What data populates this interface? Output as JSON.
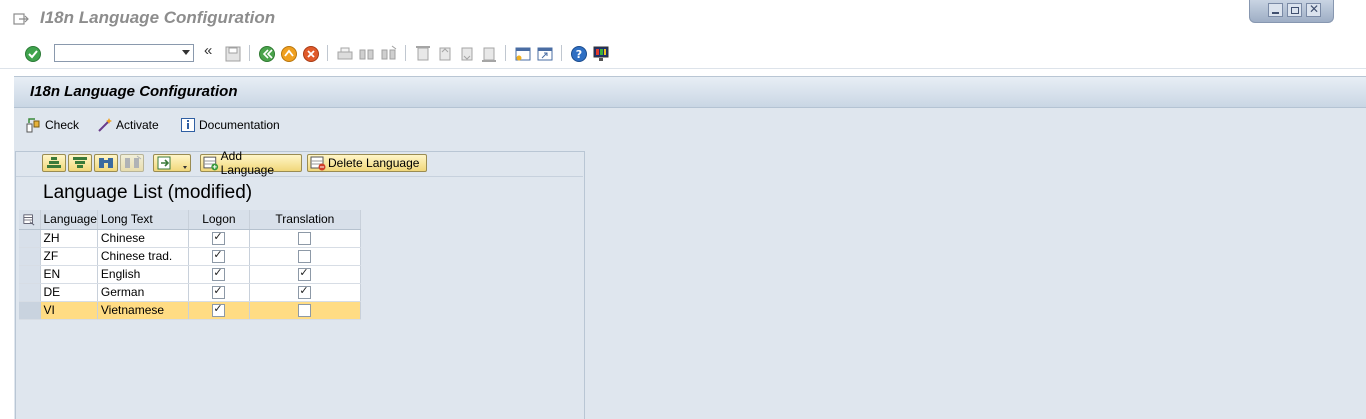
{
  "window": {
    "title": "I18n Language Configuration"
  },
  "toolbar": {
    "command_value": ""
  },
  "screen": {
    "title": "I18n Language Configuration"
  },
  "appbar": {
    "check_label": "Check",
    "activate_label": "Activate",
    "documentation_label": "Documentation"
  },
  "alv": {
    "add_label": "Add Language",
    "delete_label": "Delete Language",
    "title": "Language List (modified)",
    "columns": [
      "Language",
      "Long Text",
      "Logon",
      "Translation"
    ],
    "rows": [
      {
        "language": "ZH",
        "long_text": "Chinese",
        "logon": true,
        "translation": false
      },
      {
        "language": "ZF",
        "long_text": "Chinese trad.",
        "logon": true,
        "translation": false
      },
      {
        "language": "EN",
        "long_text": "English",
        "logon": true,
        "translation": true
      },
      {
        "language": "DE",
        "long_text": "German",
        "logon": true,
        "translation": true
      },
      {
        "language": "VI",
        "long_text": "Vietnamese",
        "logon": true,
        "translation": false,
        "selected": true
      }
    ]
  },
  "colors": {
    "highlight_row": "#ffdc84",
    "button_yellow": "#f1d77b"
  }
}
